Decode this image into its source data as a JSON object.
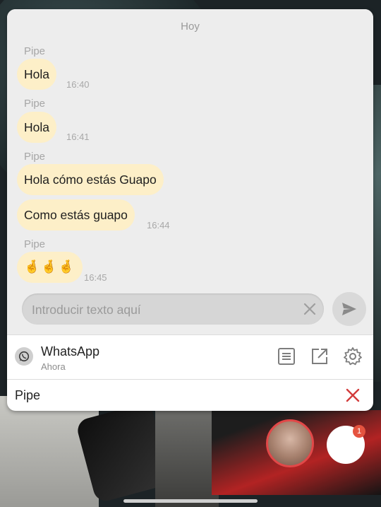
{
  "chat": {
    "day_label": "Hoy",
    "groups": [
      {
        "sender": "Pipe",
        "messages": [
          {
            "text": "Hola",
            "time": "16:40"
          }
        ]
      },
      {
        "sender": "Pipe",
        "messages": [
          {
            "text": "Hola",
            "time": "16:41"
          }
        ]
      },
      {
        "sender": "Pipe",
        "messages": [
          {
            "text": "Hola cómo estás Guapo",
            "time": ""
          },
          {
            "text": "Como estás guapo",
            "time": "16:44"
          }
        ]
      },
      {
        "sender": "Pipe",
        "messages": [
          {
            "text": "🤞🤞🤞",
            "time": "16:45"
          }
        ]
      }
    ]
  },
  "composer": {
    "placeholder": "Introducir texto aquí",
    "value": ""
  },
  "notification": {
    "app_name": "WhatsApp",
    "time": "Ahora",
    "reply_target": "Pipe"
  },
  "icons": {
    "app": "whatsapp-icon",
    "open_text": "document-icon",
    "open_external": "open-external-icon",
    "settings": "gear-icon",
    "clear": "close-icon",
    "send": "send-icon",
    "dismiss": "close-icon"
  },
  "colors": {
    "bubble": "#fdefc8",
    "dismiss": "#d23b3b",
    "badge": "#e5533f"
  },
  "chat_heads": {
    "badge_count": "1"
  }
}
